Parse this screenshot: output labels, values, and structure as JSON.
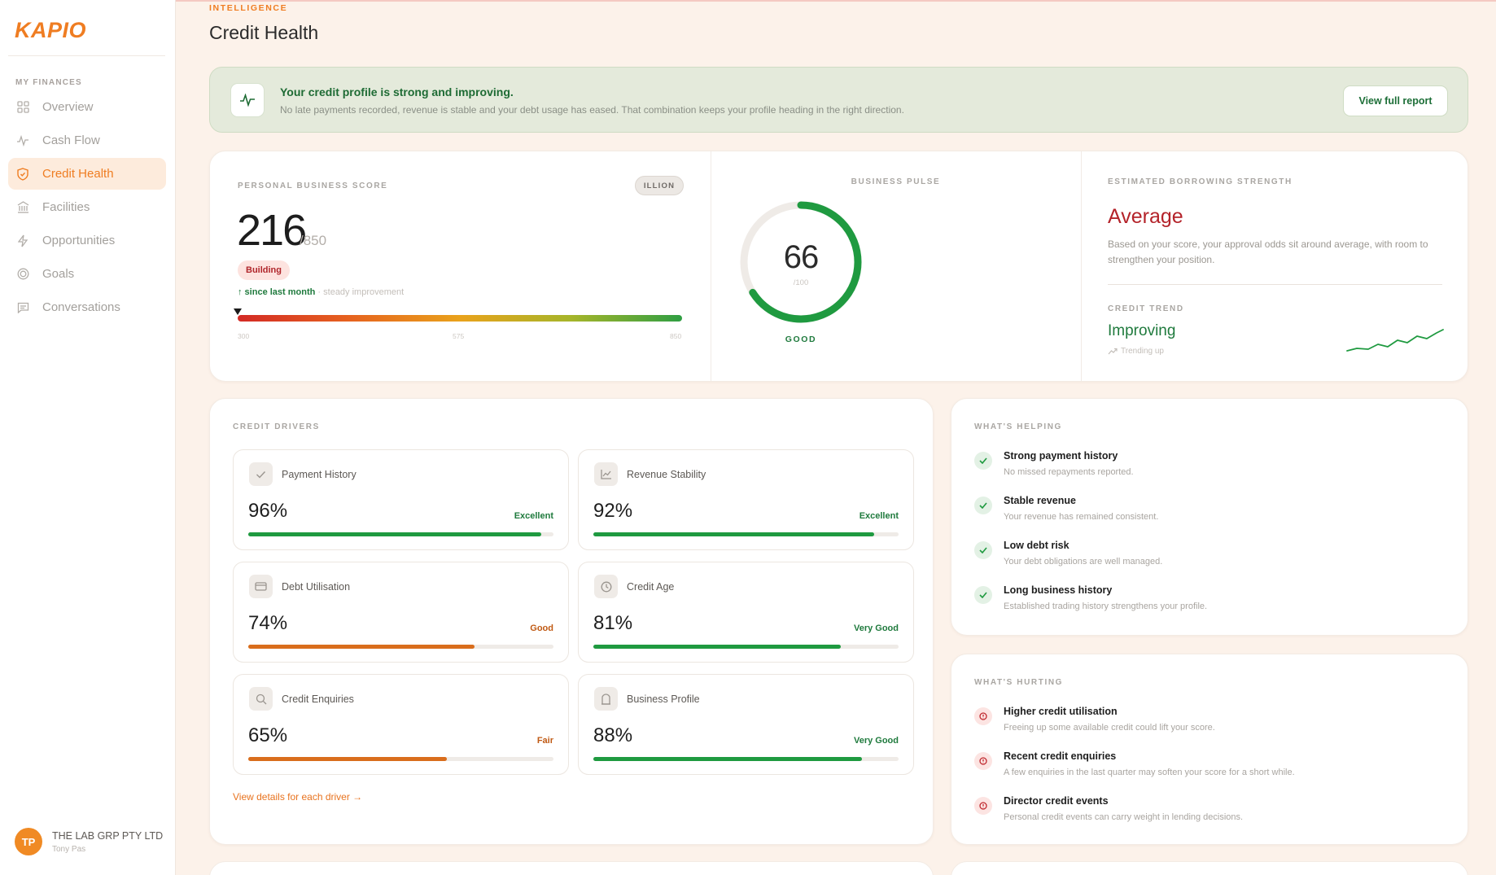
{
  "sidebar": {
    "logo": "KAPIO",
    "section_label": "MY FINANCES",
    "items": [
      {
        "label": "Overview",
        "icon": "grid-icon"
      },
      {
        "label": "Cash Flow",
        "icon": "pulse-icon"
      },
      {
        "label": "Credit Health",
        "icon": "shield-icon",
        "active": true
      },
      {
        "label": "Facilities",
        "icon": "bank-icon"
      },
      {
        "label": "Opportunities",
        "icon": "bolt-icon"
      },
      {
        "label": "Goals",
        "icon": "target-icon"
      },
      {
        "label": "Conversations",
        "icon": "chat-icon"
      }
    ],
    "user": {
      "initials": "TP",
      "company": "THE LAB GRP PTY LTD",
      "name": "Tony Pas"
    }
  },
  "header": {
    "eyebrow": "INTELLIGENCE",
    "title": "Credit Health"
  },
  "banner": {
    "title": "Your credit profile is strong and improving.",
    "description": "No late payments recorded, revenue is stable and your debt usage has eased. That combination keeps your profile heading in the right direction.",
    "button_label": "View full report"
  },
  "score": {
    "label": "PERSONAL BUSINESS SCORE",
    "provider": "ILLION",
    "value": "216",
    "max": "/850",
    "status": "Building",
    "change": "↑ since last month",
    "change_note": "· steady improvement",
    "scale_ticks": [
      "300",
      "575",
      "850"
    ],
    "marker_fraction": 0
  },
  "pulse": {
    "label": "BUSINESS PULSE",
    "value": "66",
    "max": "/100",
    "rating": "GOOD",
    "fraction": 0.66
  },
  "borrowing": {
    "label": "ESTIMATED BORROWING STRENGTH",
    "value": "Average",
    "description": "Based on your score, your approval odds sit around average, with room to strengthen your position.",
    "trend_label": "CREDIT TREND",
    "trend_value": "Improving",
    "trend_sub": "Trending up"
  },
  "drivers": {
    "label": "CREDIT DRIVERS",
    "items": [
      {
        "name": "Payment History",
        "value": "96%",
        "rating": "Excellent",
        "fraction": 0.96,
        "color": "#1f9a40",
        "rating_color": "#1f7a3d",
        "icon": "check-icon"
      },
      {
        "name": "Revenue Stability",
        "value": "92%",
        "rating": "Excellent",
        "fraction": 0.92,
        "color": "#1f9a40",
        "rating_color": "#1f7a3d",
        "icon": "chart-icon"
      },
      {
        "name": "Debt Utilisation",
        "value": "74%",
        "rating": "Good",
        "fraction": 0.74,
        "color": "#d96d1c",
        "rating_color": "#c05a14",
        "icon": "card-icon"
      },
      {
        "name": "Credit Age",
        "value": "81%",
        "rating": "Very Good",
        "fraction": 0.81,
        "color": "#1f9a40",
        "rating_color": "#1f7a3d",
        "icon": "clock-icon"
      },
      {
        "name": "Credit Enquiries",
        "value": "65%",
        "rating": "Fair",
        "fraction": 0.65,
        "color": "#d96d1c",
        "rating_color": "#c05a14",
        "icon": "search-icon"
      },
      {
        "name": "Business Profile",
        "value": "88%",
        "rating": "Very Good",
        "fraction": 0.88,
        "color": "#1f9a40",
        "rating_color": "#1f7a3d",
        "icon": "building-icon"
      }
    ],
    "link": "View details for each driver →"
  },
  "helping": {
    "label": "WHAT'S HELPING",
    "items": [
      {
        "title": "Strong payment history",
        "desc": "No missed repayments reported."
      },
      {
        "title": "Stable revenue",
        "desc": "Your revenue has remained consistent."
      },
      {
        "title": "Low debt risk",
        "desc": "Your debt obligations are well managed."
      },
      {
        "title": "Long business history",
        "desc": "Established trading history strengthens your profile."
      }
    ]
  },
  "hurting": {
    "label": "WHAT'S HURTING",
    "items": [
      {
        "title": "Higher credit utilisation",
        "desc": "Freeing up some available credit could lift your score."
      },
      {
        "title": "Recent credit enquiries",
        "desc": "A few enquiries in the last quarter may soften your score for a short while."
      },
      {
        "title": "Director credit events",
        "desc": "Personal credit events can carry weight in lending decisions."
      }
    ]
  },
  "colors": {
    "accent": "#ef7d22",
    "good": "#1f7a3d",
    "bad": "#b4232a"
  }
}
